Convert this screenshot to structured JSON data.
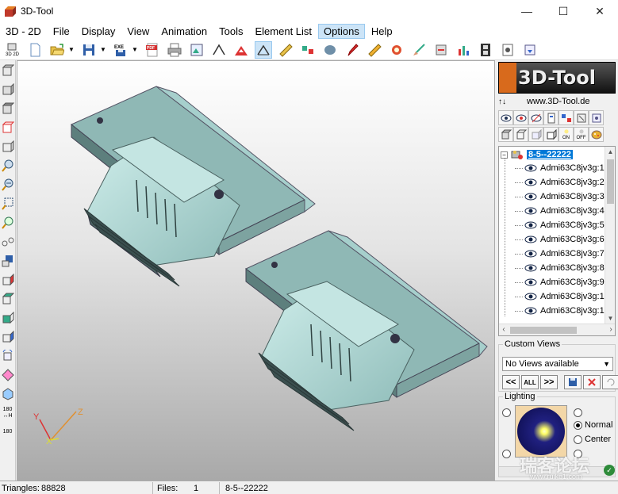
{
  "window": {
    "title": "3D-Tool",
    "icon": "app-3dtool-icon"
  },
  "window_buttons": {
    "minimize": "—",
    "maximize": "☐",
    "close": "✕"
  },
  "menu": {
    "items": [
      {
        "label": "3D - 2D",
        "active": false
      },
      {
        "label": "File",
        "active": false
      },
      {
        "label": "Display",
        "active": false
      },
      {
        "label": "View",
        "active": false
      },
      {
        "label": "Animation",
        "active": false
      },
      {
        "label": "Tools",
        "active": false
      },
      {
        "label": "Element List",
        "active": false
      },
      {
        "label": "Options",
        "active": true
      },
      {
        "label": "Help",
        "active": false
      }
    ]
  },
  "toolbar": {
    "icons": [
      "3d-2d-icon",
      "new-file-icon",
      "open-folder-icon",
      "save-icon",
      "exe-export-icon",
      "pdf-export-icon",
      "print-icon",
      "image-export-icon",
      "measure-angle-icon",
      "section-icon",
      "section-active-icon",
      "ruler-icon",
      "explode-icon",
      "solid-view-icon",
      "pen-icon",
      "ruler-2-icon",
      "redline-icon",
      "brush-icon",
      "settings-icon",
      "chart-icon",
      "film-icon",
      "properties-icon",
      "export-icon"
    ],
    "labels": {
      "three_d": "3D 2D",
      "exe": "EXE",
      "pdf": "PDF"
    }
  },
  "left_toolbar": {
    "icons": [
      "front-view-icon",
      "back-view-icon",
      "top-view-icon",
      "bottom-view-icon",
      "left-view-icon",
      "zoom-in-icon",
      "zoom-out-icon",
      "zoom-window-icon",
      "zoom-fit-icon",
      "link-icon",
      "save-view-icon",
      "iso-view-1-icon",
      "iso-view-2-icon",
      "iso-view-3-icon",
      "iso-view-4-icon",
      "rotate-icon",
      "rotate-2-icon",
      "rotate-3-icon",
      "rotate-180-h-icon",
      "rotate-180-v-icon"
    ],
    "labels": {
      "rotate_h": "180 ↔H",
      "rotate_v": "180"
    }
  },
  "viewport": {
    "axes": {
      "x": "X",
      "y": "Y",
      "z": "Z"
    },
    "colors": {
      "part_face": "#a7d3d0",
      "part_side": "#6f9d9b",
      "part_dark": "#3e5a5a",
      "bg_top": "#ffffff",
      "bg_bottom": "#a9a9a9"
    }
  },
  "right_panel": {
    "logo": "3D-Tool",
    "website": "www.3D-Tool.de",
    "icon_row1": [
      "eye-show-icon",
      "eye-hide-icon",
      "eye-inverse-icon",
      "part-info-icon",
      "explode-icon",
      "filter-icon",
      "select-icon"
    ],
    "icon_row2": [
      "solid-icon",
      "wire-icon",
      "transparent-icon",
      "hidden-line-icon",
      "light-on-icon",
      "light-off-icon",
      "material-icon"
    ],
    "icon_labels": {
      "on": "ON",
      "off": "OFF"
    },
    "tree": {
      "root": "8-5--22222",
      "items": [
        "Admi63C8jv3g:1",
        "Admi63C8jv3g:2",
        "Admi63C8jv3g:3",
        "Admi63C8jv3g:4",
        "Admi63C8jv3g:5",
        "Admi63C8jv3g:6",
        "Admi63C8jv3g:7",
        "Admi63C8jv3g:8",
        "Admi63C8jv3g:9",
        "Admi63C8jv3g:1",
        "Admi63C8jv3g:1"
      ],
      "expander": "−"
    },
    "custom_views": {
      "title": "Custom Views",
      "selected": "No Views available",
      "buttons": [
        "<<",
        "ALL",
        ">>"
      ]
    },
    "lighting": {
      "title": "Lighting",
      "options": [
        {
          "label": "Normal",
          "checked": true
        },
        {
          "label": "Center",
          "checked": false
        }
      ]
    }
  },
  "status_bar": {
    "triangles_label": "Triangles:",
    "triangles_value": "88828",
    "files_label": "Files:",
    "files_value": "1",
    "filename": "8-5--22222"
  },
  "watermark": {
    "main": "瑞客论坛",
    "sub": "www.ruike1.com"
  }
}
